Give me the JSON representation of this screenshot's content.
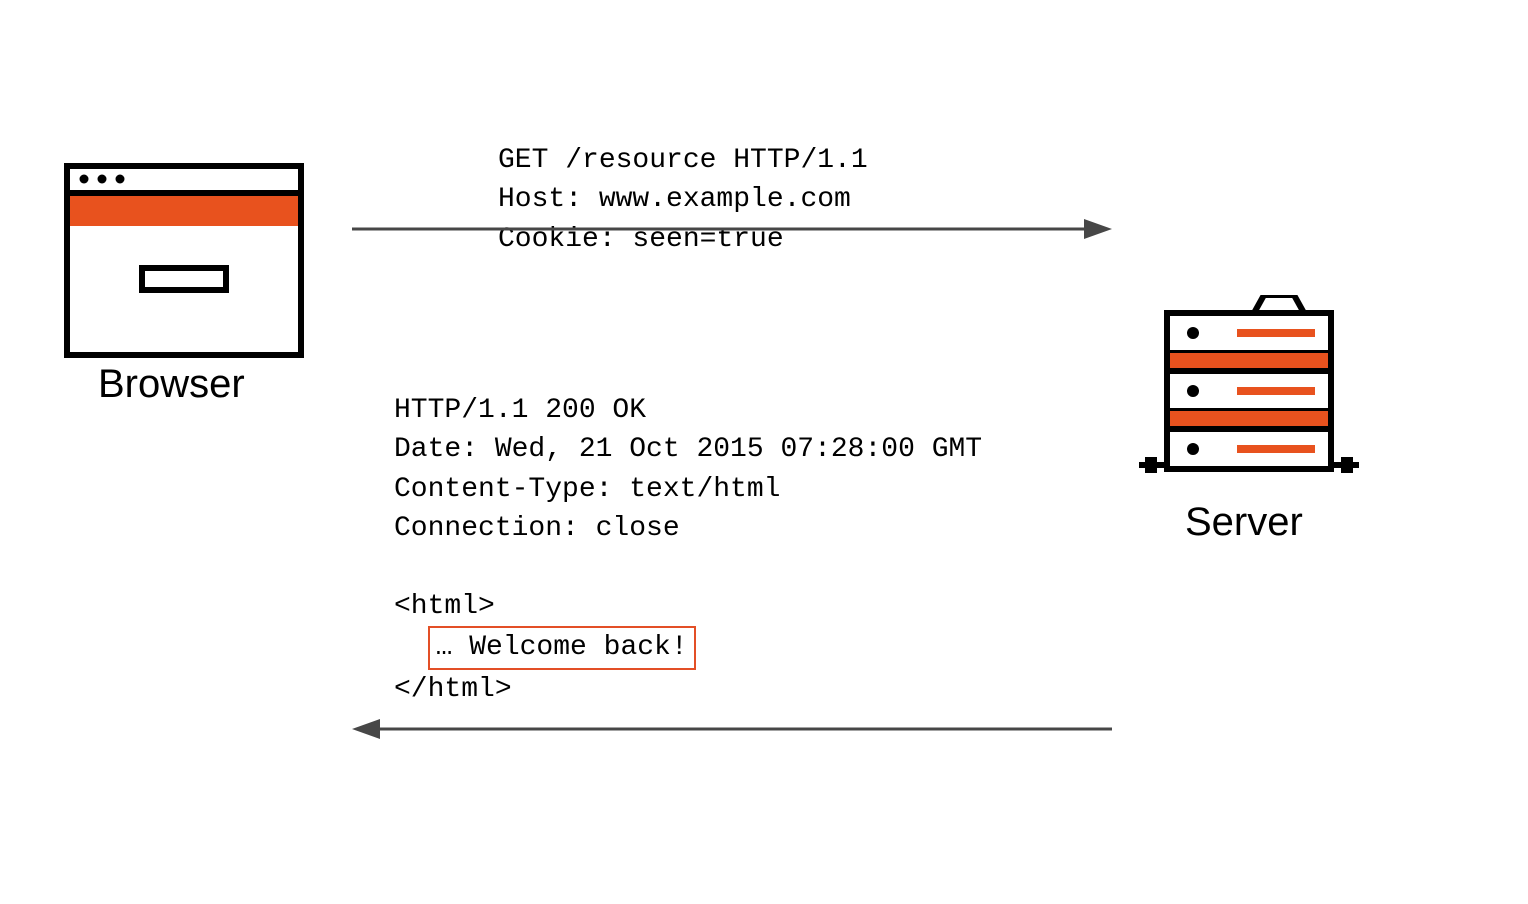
{
  "browser_label": "Browser",
  "server_label": "Server",
  "request": {
    "line1": "GET /resource HTTP/1.1",
    "line2": "Host: www.example.com",
    "line3": "Cookie: seen=true"
  },
  "response": {
    "line1": "HTTP/1.1 200 OK",
    "line2": "Date: Wed, 21 Oct 2015 07:28:00 GMT",
    "line3": "Content-Type: text/html",
    "line4": "Connection: close",
    "body_open": "<html>",
    "body_content": "… Welcome back!",
    "body_close": "</html>"
  },
  "colors": {
    "accent": "#e8521e",
    "stroke": "#000000",
    "arrow": "#474747"
  }
}
